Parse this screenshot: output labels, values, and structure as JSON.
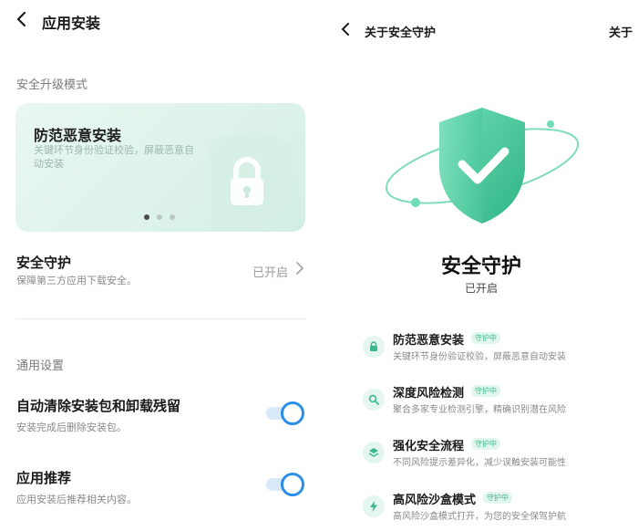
{
  "left": {
    "title": "应用安装",
    "section_security": "安全升级模式",
    "banner": {
      "title": "防范恶意安装",
      "desc": "关键环节身份验证校验，屏蔽恶意自动安装"
    },
    "guard": {
      "title": "安全守护",
      "sub": "保障第三方应用下载安全。",
      "value": "已开启"
    },
    "section_general": "通用设置",
    "auto_clean": {
      "title": "自动清除安装包和卸载残留",
      "sub": "安装完成后删除安装包。",
      "enabled": true
    },
    "recommend": {
      "title": "应用推荐",
      "sub": "应用安装后推荐相关内容。",
      "enabled": true
    }
  },
  "right": {
    "title": "关于安全守护",
    "top_right": "关于",
    "hero_title": "安全守护",
    "hero_status": "已开启",
    "badge": "守护中",
    "features": [
      {
        "icon": "lock-icon",
        "title": "防范恶意安装",
        "desc": "关键环节身份验证校验，屏蔽恶意自动安装"
      },
      {
        "icon": "search-icon",
        "title": "深度风险检测",
        "desc": "聚合多家专业检测引擎，精确识别潜在风险"
      },
      {
        "icon": "layers-icon",
        "title": "强化安全流程",
        "desc": "不同风险提示差异化，减少误触安装可能性"
      },
      {
        "icon": "lightning-icon",
        "title": "高风险沙盒模式",
        "desc": "高风险沙盒模式打开，为您的安全保驾护航"
      }
    ]
  },
  "colors": {
    "accent_green": "#3cb98c",
    "toggle_blue": "#2c8ee9"
  }
}
